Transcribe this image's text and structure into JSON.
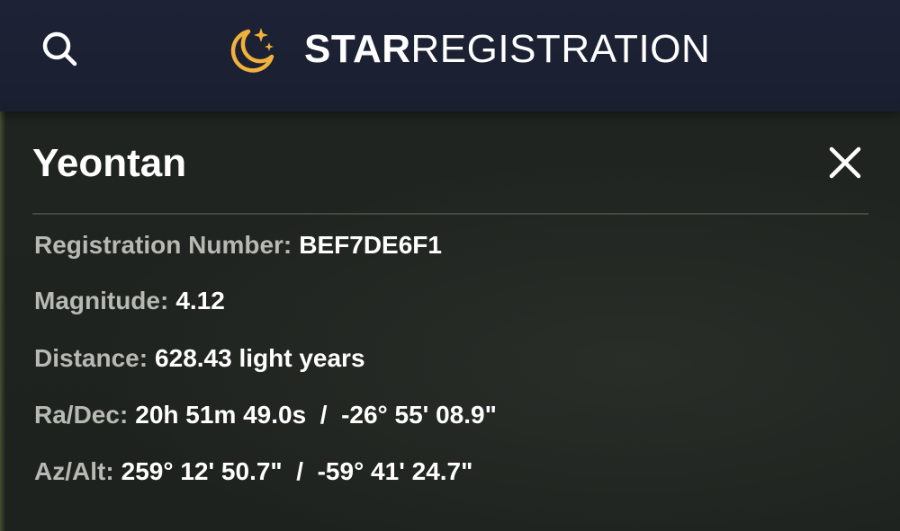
{
  "header": {
    "search_icon": "search-icon",
    "logo_icon": "moon-stars-icon",
    "logo_strong": "STAR",
    "logo_light": "REGISTRATION",
    "logo_icon_color": "#f2b13c"
  },
  "star": {
    "name": "Yeontan",
    "close_icon": "close-icon",
    "details": [
      {
        "label": "Registration Number:",
        "value": "BEF7DE6F1"
      },
      {
        "label": "Magnitude:",
        "value": "4.12"
      },
      {
        "label": "Distance:",
        "value": "628.43 light years"
      },
      {
        "label": "Ra/Dec:",
        "value": "20h 51m 49.0s  /  -26° 55' 08.9\""
      },
      {
        "label": "Az/Alt:",
        "value": "259° 12' 50.7\"  /  -59° 41' 24.7\""
      }
    ]
  }
}
